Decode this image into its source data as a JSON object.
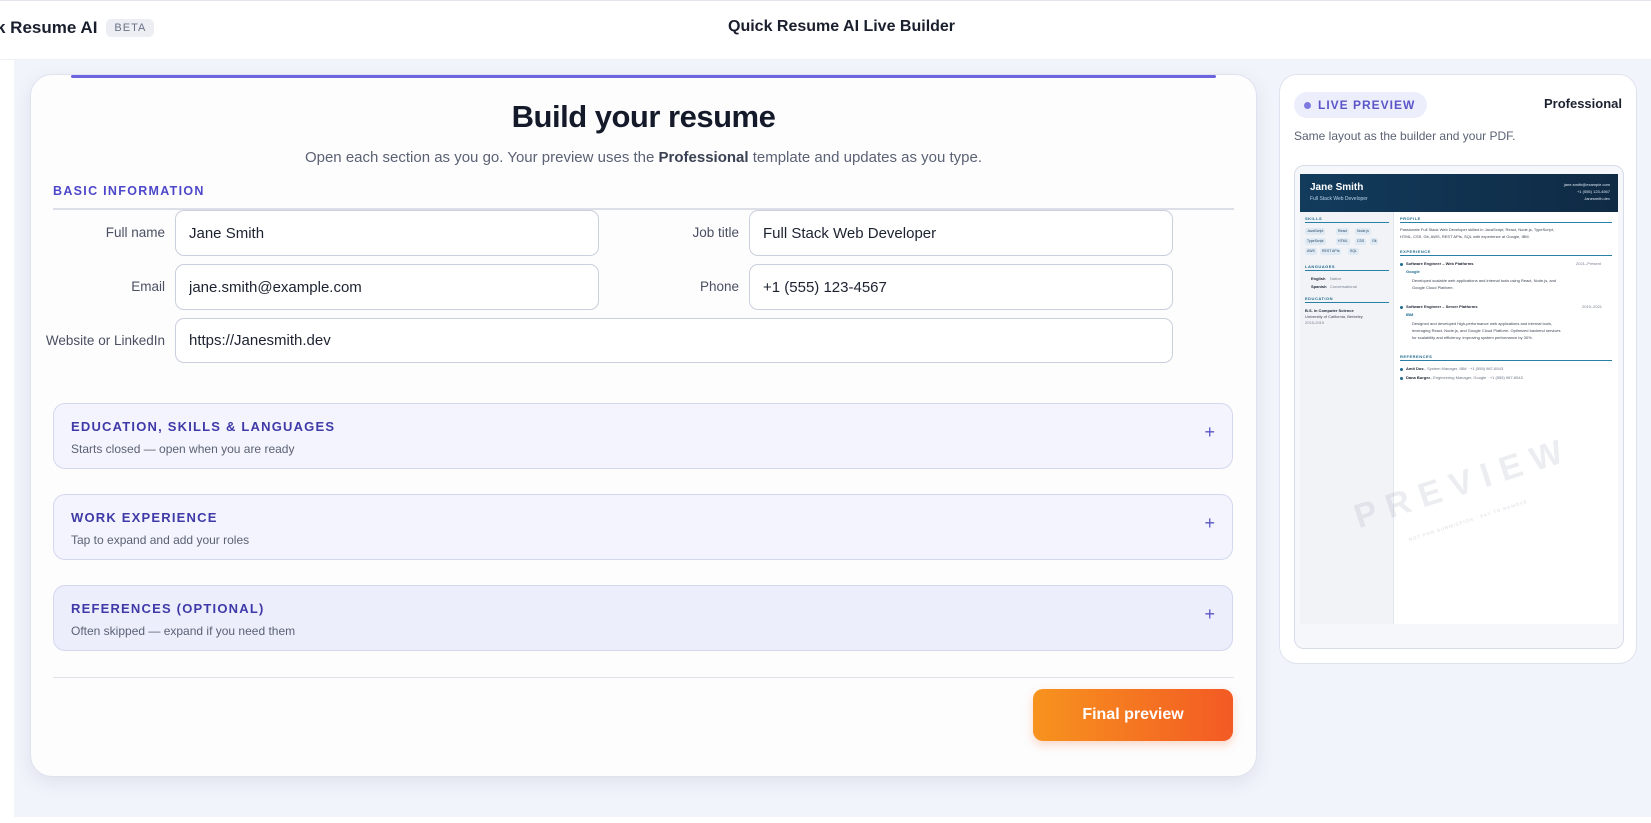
{
  "app": {
    "brand": "k Resume AI",
    "badge": "BETA",
    "title": "Quick Resume AI Live Builder"
  },
  "form": {
    "heading": "Build your resume",
    "subtitle_pre": "Open each section as you go. Your preview uses the ",
    "subtitle_template": "Professional",
    "subtitle_post": " template and updates as you type.",
    "basic_section": "BASIC INFORMATION",
    "fields": {
      "full_name": {
        "label": "Full name",
        "value": "Jane Smith"
      },
      "job_title": {
        "label": "Job title",
        "value": "Full Stack Web Developer"
      },
      "email": {
        "label": "Email",
        "value": "jane.smith@example.com"
      },
      "phone": {
        "label": "Phone",
        "value": "+1 (555) 123-4567"
      },
      "website": {
        "label": "Website or LinkedIn",
        "value": "https://Janesmith.dev"
      }
    },
    "accordions": [
      {
        "title": "EDUCATION, SKILLS & LANGUAGES",
        "subtitle": "Starts closed — open when you are ready",
        "icon": "+"
      },
      {
        "title": "WORK EXPERIENCE",
        "subtitle": "Tap to expand and add your roles",
        "icon": "+"
      },
      {
        "title": "REFERENCES (OPTIONAL)",
        "subtitle": "Often skipped — expand if you need them",
        "icon": "+"
      }
    ],
    "final_button": "Final preview"
  },
  "preview": {
    "badge": "LIVE PREVIEW",
    "template": "Professional",
    "subtitle": "Same layout as the builder and your PDF.",
    "doc": {
      "name": "Jane Smith",
      "role": "Full Stack Web Developer",
      "contact": [
        "jane.smith@example.com",
        "+1 (555) 123-4567",
        "Janesmith.dev"
      ],
      "skills_h": "SKILLS",
      "skills": [
        "JavaScript",
        "React",
        "Node.js",
        "TypeScript",
        "HTML",
        "CSS",
        "Git",
        "AWS",
        "REST APIs",
        "SQL"
      ],
      "languages_h": "LANGUAGES",
      "languages": [
        {
          "name": "English",
          "level": "Native"
        },
        {
          "name": "Spanish",
          "level": "Conversational"
        }
      ],
      "education_h": "EDUCATION",
      "education": {
        "degree": "B.S. in Computer Science",
        "school": "University of California, Berkeley",
        "years": "2015-2019"
      },
      "profile_h": "PROFILE",
      "profile": [
        "Passionate Full Stack Web Developer skilled in JavaScript, React, Node.js, TypeScript,",
        "HTML, CSS, Git, AWS, REST APIs, SQL with experience at Google, IBM."
      ],
      "experience_h": "EXPERIENCE",
      "jobs": [
        {
          "title": "Software Engineer – Web Platforms",
          "dates": "2021–Present",
          "company": "Google",
          "lines": [
            "Developed scalable web applications and internal tools using React, Node.js, and",
            "Google Cloud Platform."
          ]
        },
        {
          "title": "Software Engineer – Server Platforms",
          "dates": "2019–2021",
          "company": "IBM",
          "lines": [
            "Designed and developed high-performance web applications and internal tools,",
            "leveraging React, Node.js, and Google Cloud Platform. Optimized backend services",
            "for scalability and efficiency, improving system performance by 30%."
          ]
        }
      ],
      "references_h": "REFERENCES",
      "references": [
        {
          "name": "Amit Doe",
          "detail": " — System Manager, IBM · +1 (555) 987-6543"
        },
        {
          "name": "Dana Burger",
          "detail": " — Engineering Manager, Google · +1 (555) 987-6543"
        }
      ],
      "watermark": "PREVIEW",
      "watermark_sub": "NOT FOR SUBMISSION · PAY TO REMOVE"
    }
  },
  "colors": {
    "accent": "#4d48c9",
    "cta_start": "#f7931e",
    "cta_end": "#f35a24",
    "doc_header": "#123b5c"
  }
}
